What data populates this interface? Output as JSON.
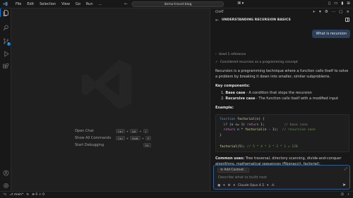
{
  "titlebar": {
    "menu": [
      "File",
      "Edit",
      "Selection",
      "View",
      "Go",
      "Run",
      "…"
    ],
    "search_text": "demo-travel-blog"
  },
  "editor": {
    "shortcuts": [
      {
        "label": "Open Chat",
        "keys": [
          "Ctrl",
          "Alt",
          "I"
        ]
      },
      {
        "label": "Show All Commands",
        "keys": [
          "Ctrl",
          "Shift",
          "P"
        ]
      },
      {
        "label": "Start Debugging",
        "keys": [
          "F5"
        ]
      }
    ]
  },
  "chat": {
    "header": "CHAT",
    "title": "UNDERSTANDING RECURSION BASICS",
    "user_message": "What is recursion",
    "used_references": "Used 1 reference",
    "considered": "Considered recursion as a programming concept",
    "intro": "Recursion is a programming technique where a function calls itself to solve a problem by breaking it down into smaller, similar subproblems.",
    "key_components_heading": "Key components:",
    "components": [
      {
        "num": "1.",
        "term": "Base case",
        "desc": " - A condition that stops the recursion"
      },
      {
        "num": "2.",
        "term": "Recursive case",
        "desc": " - The function calls itself with a modified input"
      }
    ],
    "example_heading": "Example:",
    "code_lines": [
      "function factorial(n) {",
      "  if (n <= 1) return 1;          // base case",
      "  return n * factorial(n - 1);  // recursive case",
      "}",
      "",
      "factorial(5); // 5 * 4 * 3 * 2 * 1 = 120"
    ],
    "common_uses_label": "Common uses:",
    "common_uses_text": " Tree traversal, directory scanning, divide-and-conquer algorithms, mathematical sequences (Fibonacci), factorial).",
    "input": {
      "add_context": "Add Context...",
      "placeholder": "Describe what to build next",
      "model": "Claude Opus 4.5"
    }
  },
  "statusbar": {
    "branch": "main*",
    "errors": "0",
    "warnings": "0"
  },
  "colors": {
    "accent": "#0078d4",
    "user_bubble": "#2b3e5a"
  }
}
